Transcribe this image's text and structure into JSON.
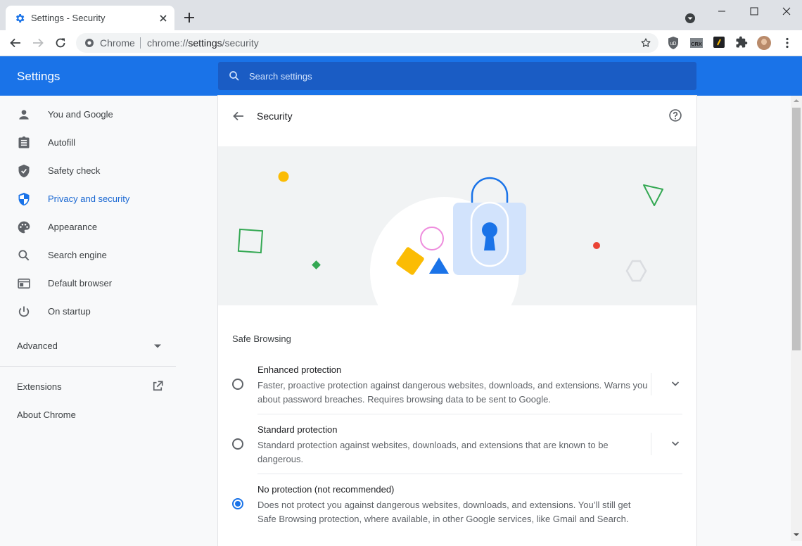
{
  "window": {
    "tab_title": "Settings - Security",
    "minimize": "minimize",
    "maximize": "maximize",
    "close": "close"
  },
  "toolbar": {
    "origin_chip": "Chrome",
    "url_scheme": "chrome://",
    "url_host": "settings",
    "url_path": "/security",
    "extensions": [
      "ublock-icon",
      "crx-icon",
      "dev-extension-icon",
      "puzzle-icon"
    ]
  },
  "header": {
    "title": "Settings",
    "search_placeholder": "Search settings"
  },
  "sidebar": {
    "items": [
      {
        "label": "You and Google",
        "icon": "person-icon",
        "active": false
      },
      {
        "label": "Autofill",
        "icon": "clipboard-icon",
        "active": false
      },
      {
        "label": "Safety check",
        "icon": "shield-check-icon",
        "active": false
      },
      {
        "label": "Privacy and security",
        "icon": "shield-half-icon",
        "active": true
      },
      {
        "label": "Appearance",
        "icon": "palette-icon",
        "active": false
      },
      {
        "label": "Search engine",
        "icon": "search-icon",
        "active": false
      },
      {
        "label": "Default browser",
        "icon": "browser-icon",
        "active": false
      },
      {
        "label": "On startup",
        "icon": "power-icon",
        "active": false
      }
    ],
    "advanced": "Advanced",
    "extensions": "Extensions",
    "about": "About Chrome"
  },
  "page": {
    "title": "Security",
    "section_title": "Safe Browsing",
    "options": [
      {
        "title": "Enhanced protection",
        "description": "Faster, proactive protection against dangerous websites, downloads, and extensions. Warns you about password breaches. Requires browsing data to be sent to Google.",
        "selected": false,
        "expandable": true
      },
      {
        "title": "Standard protection",
        "description": "Standard protection against websites, downloads, and extensions that are known to be dangerous.",
        "selected": false,
        "expandable": true
      },
      {
        "title": "No protection (not recommended)",
        "description": "Does not protect you against dangerous websites, downloads, and extensions. You’ll still get Safe Browsing protection, where available, in other Google services, like Gmail and Search.",
        "selected": true,
        "expandable": false
      }
    ]
  },
  "colors": {
    "accent": "#1a73e8",
    "header_bg": "#1a73e8",
    "active_text": "#1967d2"
  }
}
